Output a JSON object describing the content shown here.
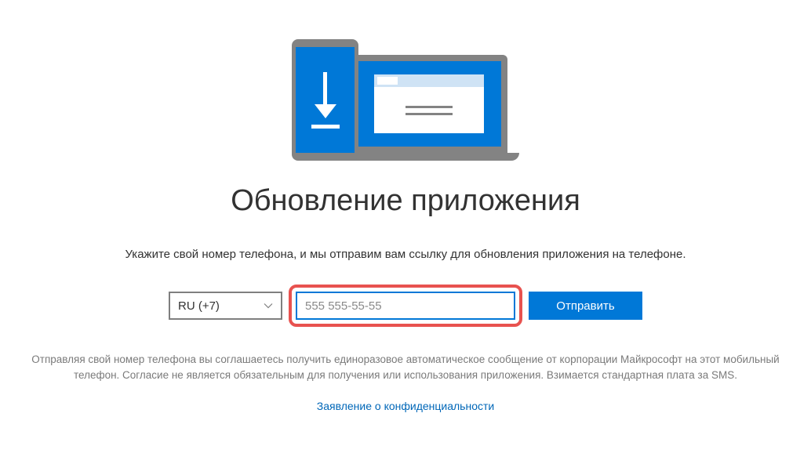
{
  "heading": "Обновление приложения",
  "instruction": "Укажите свой номер телефона, и мы отправим вам ссылку для обновления приложения на телефоне.",
  "form": {
    "country_selected": "RU (+7)",
    "phone_placeholder": "555 555-55-55",
    "phone_value": "",
    "send_label": "Отправить"
  },
  "disclaimer": "Отправляя свой номер телефона вы соглашаетесь получить единоразовое автоматическое сообщение от корпорации Майкрософт на этот мобильный телефон. Согласие не является обязательным для получения или использования приложения. Взимается стандартная плата за SMS.",
  "privacy_link": "Заявление о конфиденциальности"
}
